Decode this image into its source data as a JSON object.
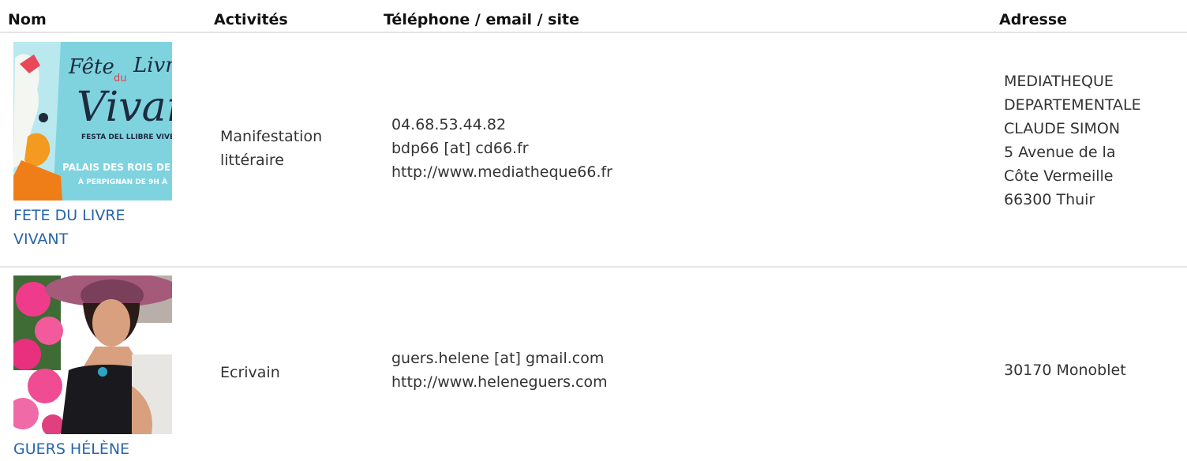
{
  "headers": {
    "nom": "Nom",
    "activites": "Activités",
    "contact": "Téléphone / email / site",
    "adresse": "Adresse"
  },
  "rows": [
    {
      "image_alt": "Fête du Livre Vivant poster",
      "image_text": {
        "fete": "Fête",
        "du": "du",
        "livre": "Livre",
        "vivant": "Vivant",
        "festa": "FESTA DEL LLIBRE VIVENT",
        "palais": "PALAIS DES ROIS DE MAJORQUE",
        "perpignan": "À PERPIGNAN DE 9H À"
      },
      "name_line1": "FETE DU LIVRE",
      "name_line2": "VIVANT",
      "activity_line1": "Manifestation",
      "activity_line2": "littéraire",
      "phone": "04.68.53.44.82",
      "email": "bdp66 [at] cd66.fr",
      "site": "http://www.mediatheque66.fr",
      "address": [
        "MEDIATHEQUE",
        "DEPARTEMENTALE",
        "CLAUDE SIMON",
        "5 Avenue de la",
        "Côte Vermeille",
        "66300 Thuir"
      ]
    },
    {
      "image_alt": "Portrait de Hélène Guers",
      "name_line1": "GUERS HÉLÈNE",
      "activity_line1": "Ecrivain",
      "email": "guers.helene [at] gmail.com",
      "site": "http://www.heleneguers.com",
      "address": [
        "30170 Monoblet"
      ]
    }
  ],
  "colors": {
    "link": "#2765a8",
    "text": "#333333",
    "divider": "#e5e5e5"
  }
}
